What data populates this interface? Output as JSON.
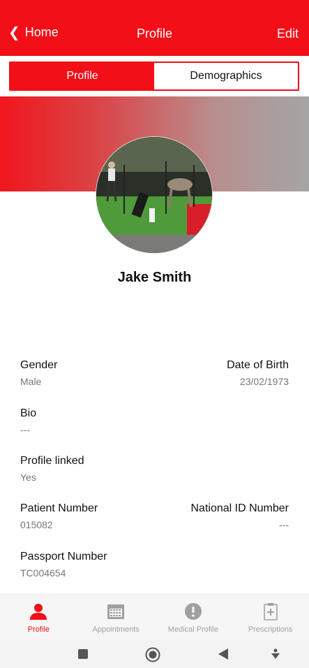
{
  "header": {
    "back_label": "Home",
    "title": "Profile",
    "edit_label": "Edit"
  },
  "segments": {
    "profile": "Profile",
    "demographics": "Demographics",
    "selected": "Profile"
  },
  "profile": {
    "name": "Jake Smith"
  },
  "fields": {
    "gender": {
      "label": "Gender",
      "value": "Male"
    },
    "dob": {
      "label": "Date of Birth",
      "value": "23/02/1973"
    },
    "bio": {
      "label": "Bio",
      "value": "---"
    },
    "linked": {
      "label": "Profile linked",
      "value": "Yes"
    },
    "patient_number": {
      "label": "Patient Number",
      "value": "015082"
    },
    "national_id": {
      "label": "National ID Number",
      "value": "---"
    },
    "passport": {
      "label": "Passport Number",
      "value": "TC004654"
    }
  },
  "tabs": [
    {
      "label": "Profile",
      "icon": "person-icon",
      "active": true
    },
    {
      "label": "Appointments",
      "icon": "calendar-icon",
      "active": false
    },
    {
      "label": "Medical Profile",
      "icon": "alert-icon",
      "active": false
    },
    {
      "label": "Prescriptions",
      "icon": "clipboard-icon",
      "active": false
    }
  ],
  "colors": {
    "accent": "#f20f17",
    "inactive": "#a0a0a0"
  }
}
